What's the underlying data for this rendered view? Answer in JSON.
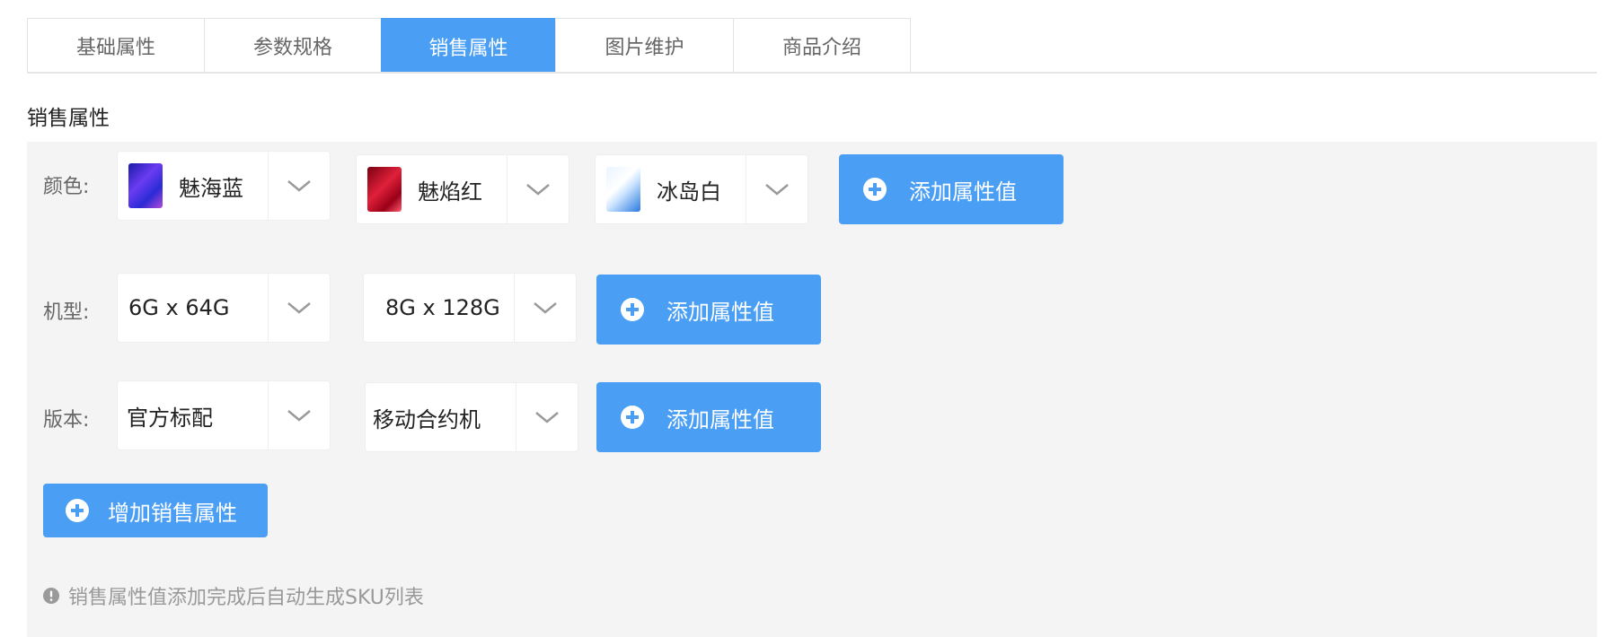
{
  "tabs": [
    {
      "label": "基础属性",
      "active": false
    },
    {
      "label": "参数规格",
      "active": false
    },
    {
      "label": "销售属性",
      "active": true
    },
    {
      "label": "图片维护",
      "active": false
    },
    {
      "label": "商品介绍",
      "active": false
    }
  ],
  "section_title": "销售属性",
  "rows": {
    "color": {
      "label": "颜色:",
      "values": [
        {
          "text": "魅海蓝",
          "thumb": "blue-phone-image"
        },
        {
          "text": "魅焰红",
          "thumb": "red-phone-image"
        },
        {
          "text": "冰岛白",
          "thumb": "white-phone-image"
        }
      ],
      "add_label": "添加属性值"
    },
    "model": {
      "label": "机型:",
      "values": [
        {
          "text": "6G x 64G"
        },
        {
          "text": "8G x 128G"
        }
      ],
      "add_label": "添加属性值"
    },
    "version": {
      "label": "版本:",
      "values": [
        {
          "text": "官方标配"
        },
        {
          "text": "移动合约机"
        }
      ],
      "add_label": "添加属性值"
    }
  },
  "add_sale_attr_label": "增加销售属性",
  "tip_text": "销售属性值添加完成后自动生成SKU列表",
  "icons": {
    "dropdown": "chevron-down-icon",
    "add": "plus-circle-icon",
    "tip": "exclamation-circle-icon"
  },
  "colors": {
    "accent": "#4a9ff5",
    "panel_bg": "#f4f4f4",
    "muted_text": "#999999"
  }
}
